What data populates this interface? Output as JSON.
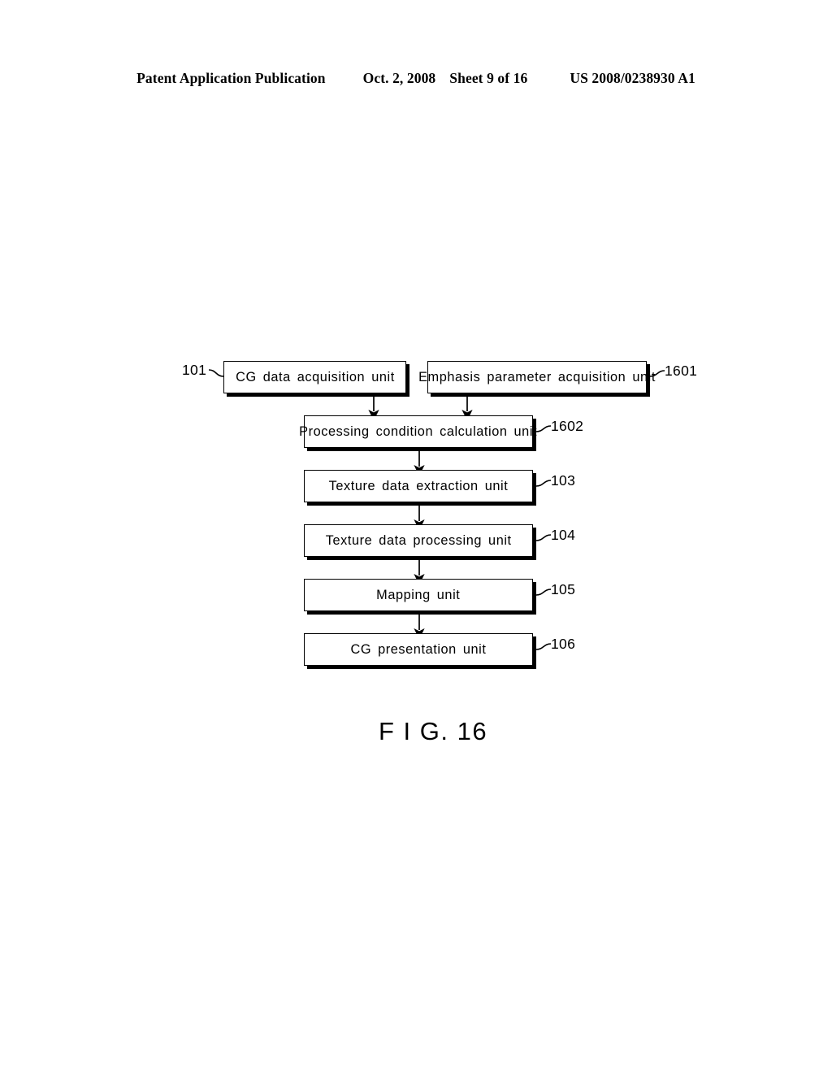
{
  "header": {
    "publication": "Patent Application Publication",
    "date": "Oct. 2, 2008",
    "sheet": "Sheet 9 of 16",
    "patent_number": "US 2008/0238930 A1"
  },
  "figure": {
    "caption": "F I G. 16",
    "nodes": [
      {
        "id": "cg-data-acquisition",
        "label": "CG data acquisition unit",
        "ref": "101"
      },
      {
        "id": "emphasis-parameter",
        "label": "Emphasis parameter acquisition unit",
        "ref": "1601"
      },
      {
        "id": "processing-condition",
        "label": "Processing condition calculation unit",
        "ref": "1602"
      },
      {
        "id": "texture-data-extraction",
        "label": "Texture data extraction unit",
        "ref": "103"
      },
      {
        "id": "texture-data-processing",
        "label": "Texture data processing unit",
        "ref": "104"
      },
      {
        "id": "mapping",
        "label": "Mapping unit",
        "ref": "105"
      },
      {
        "id": "cg-presentation",
        "label": "CG presentation unit",
        "ref": "106"
      }
    ]
  }
}
